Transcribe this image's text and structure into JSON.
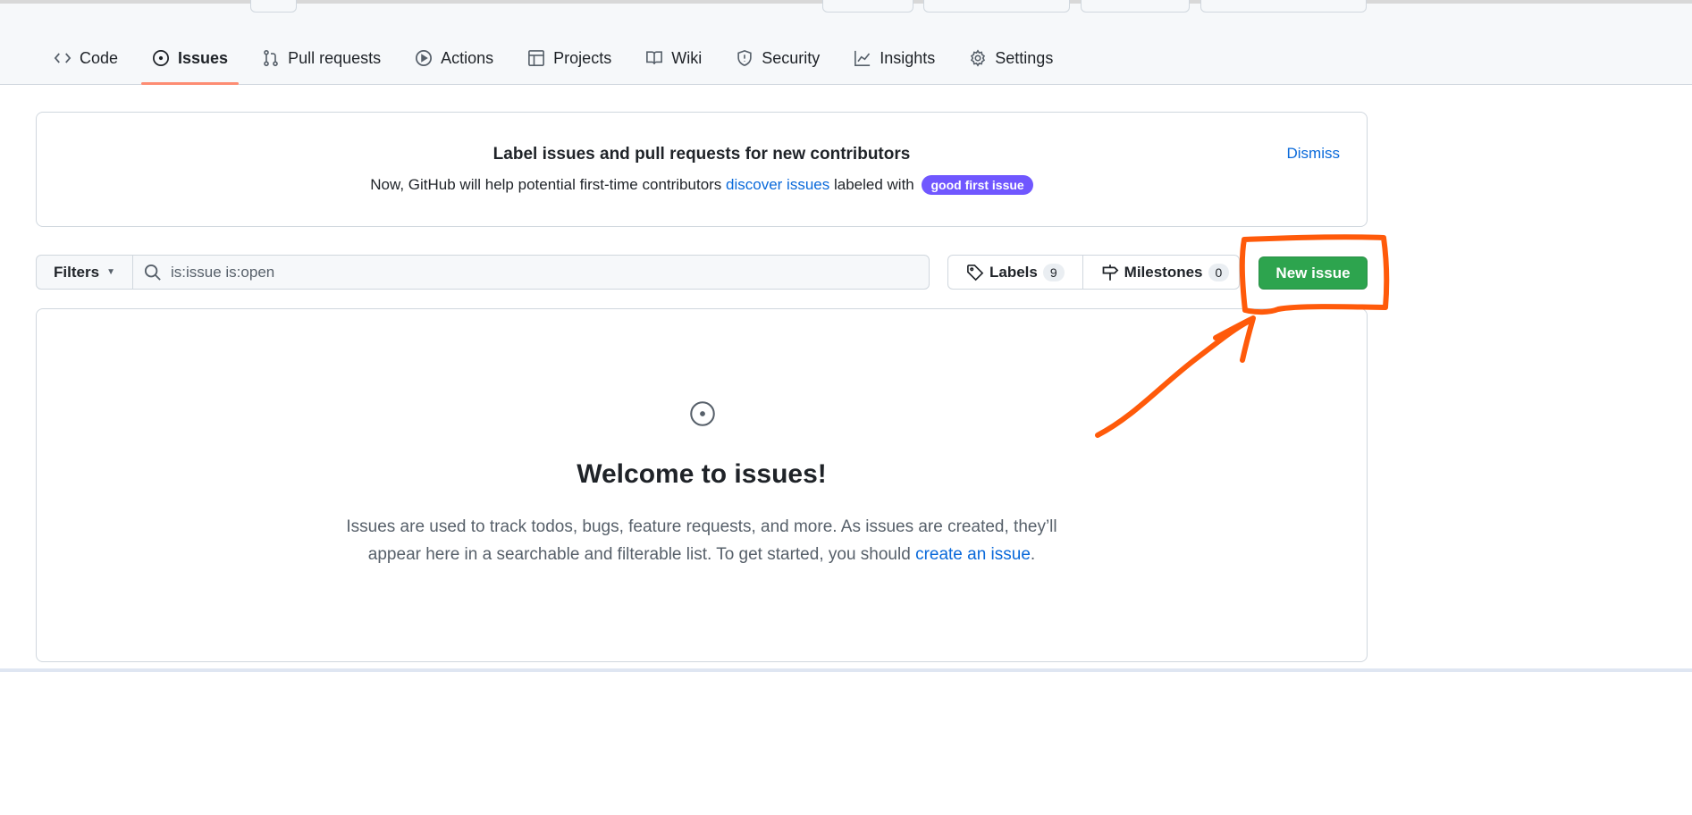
{
  "tabs": [
    {
      "label": "Code",
      "icon": "code-icon"
    },
    {
      "label": "Issues",
      "icon": "issue-opened-icon",
      "selected": true
    },
    {
      "label": "Pull requests",
      "icon": "git-pull-request-icon"
    },
    {
      "label": "Actions",
      "icon": "play-icon"
    },
    {
      "label": "Projects",
      "icon": "table-icon"
    },
    {
      "label": "Wiki",
      "icon": "book-icon"
    },
    {
      "label": "Security",
      "icon": "shield-icon"
    },
    {
      "label": "Insights",
      "icon": "graph-icon"
    },
    {
      "label": "Settings",
      "icon": "gear-icon"
    }
  ],
  "banner": {
    "title": "Label issues and pull requests for new contributors",
    "text_before": "Now, GitHub will help potential first-time contributors ",
    "link": "discover issues",
    "text_after": " labeled with ",
    "badge": "good first issue",
    "badge_color": "#7057ff",
    "dismiss": "Dismiss"
  },
  "toolbar": {
    "filters": "Filters",
    "search_value": "is:issue is:open",
    "labels": "Labels",
    "labels_count": "9",
    "milestones": "Milestones",
    "milestones_count": "0",
    "new_issue": "New issue",
    "new_issue_color": "#2da44e"
  },
  "blankslate": {
    "title": "Welcome to issues!",
    "line1": "Issues are used to track todos, bugs, feature requests, and more. As issues are created, they’ll",
    "line2_before": "appear here in a searchable and filterable list. To get started, you should ",
    "link": "create an issue",
    "line2_after": "."
  },
  "annotation_color": "#ff5a0a"
}
